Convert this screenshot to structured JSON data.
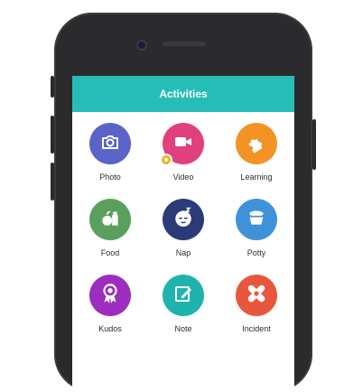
{
  "header": {
    "title": "Activities"
  },
  "activities": [
    {
      "label": "Photo",
      "color": "#5b63c9",
      "icon": "camera-icon"
    },
    {
      "label": "Video",
      "color": "#e0407d",
      "icon": "video-camera-icon",
      "badge": true
    },
    {
      "label": "Learning",
      "color": "#f39325",
      "icon": "puzzle-icon"
    },
    {
      "label": "Food",
      "color": "#5aa05c",
      "icon": "food-icon"
    },
    {
      "label": "Nap",
      "color": "#2b3b78",
      "icon": "baby-sleeping-icon"
    },
    {
      "label": "Potty",
      "color": "#3f92d8",
      "icon": "potty-icon"
    },
    {
      "label": "Kudos",
      "color": "#9c2dc0",
      "icon": "award-ribbon-icon"
    },
    {
      "label": "Note",
      "color": "#1fb3ad",
      "icon": "edit-note-icon"
    },
    {
      "label": "Incident",
      "color": "#e8573d",
      "icon": "bandage-icon"
    }
  ]
}
